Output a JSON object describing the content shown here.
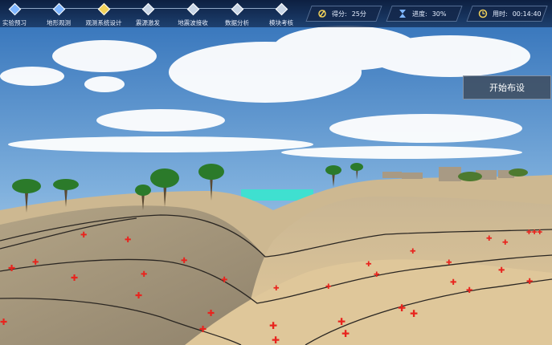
{
  "steps": [
    {
      "label": "实验预习",
      "state": "done"
    },
    {
      "label": "地形观测",
      "state": "done"
    },
    {
      "label": "观测系统设计",
      "state": "active"
    },
    {
      "label": "震源激发",
      "state": "pending"
    },
    {
      "label": "地震波接收",
      "state": "pending"
    },
    {
      "label": "数据分析",
      "state": "pending"
    },
    {
      "label": "模块考核",
      "state": "pending"
    }
  ],
  "stats": {
    "score": {
      "label": "得分:",
      "value": "25分",
      "icon": "score-icon"
    },
    "progress": {
      "label": "进度:",
      "value": "30%",
      "icon": "hourglass-icon"
    },
    "time": {
      "label": "用时:",
      "value": "00:14:40",
      "icon": "clock-icon"
    }
  },
  "start_button": "开始布设",
  "colors": {
    "sky": "#3d7fc4",
    "sand": "#d9c39a",
    "marker": "#e8241e",
    "water": "#3fe0d0"
  }
}
